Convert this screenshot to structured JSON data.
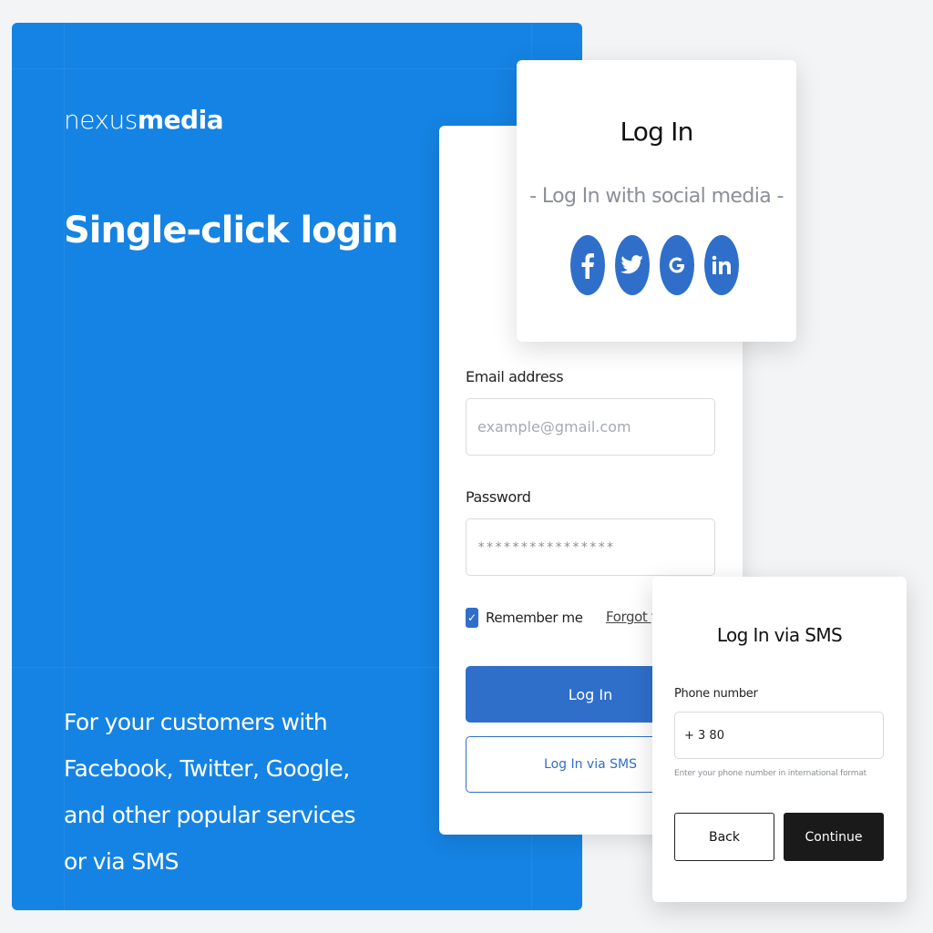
{
  "hero": {
    "logo_light": "nexus",
    "logo_bold": "media",
    "title": "Single-click login",
    "description": "For your customers with Facebook, Twitter, Google, and other popular services or via SMS"
  },
  "login_form": {
    "email_label": "Email address",
    "email_placeholder": "example@gmail.com",
    "password_label": "Password",
    "password_value": "****************",
    "remember_label": "Remember me",
    "remember_checked": true,
    "forgot_label": "Forgot your password?",
    "login_button": "Log In",
    "sms_button": "Log In via SMS"
  },
  "social_login": {
    "title": "Log In",
    "subtitle": "- Log In with social media -",
    "providers": [
      {
        "name": "facebook",
        "icon": "facebook-icon"
      },
      {
        "name": "twitter",
        "icon": "twitter-icon"
      },
      {
        "name": "google",
        "icon": "google-icon"
      },
      {
        "name": "linkedin",
        "icon": "linkedin-icon"
      }
    ]
  },
  "sms_login": {
    "title": "Log In via SMS",
    "phone_label": "Phone number",
    "phone_value": "+ 3 80",
    "hint": "Enter your phone number in international format",
    "back_button": "Back",
    "continue_button": "Continue"
  },
  "colors": {
    "hero_blue": "#1583e3",
    "primary_blue": "#2f6fca",
    "dark_button": "#1a1a1a",
    "page_background": "#f3f4f6"
  }
}
